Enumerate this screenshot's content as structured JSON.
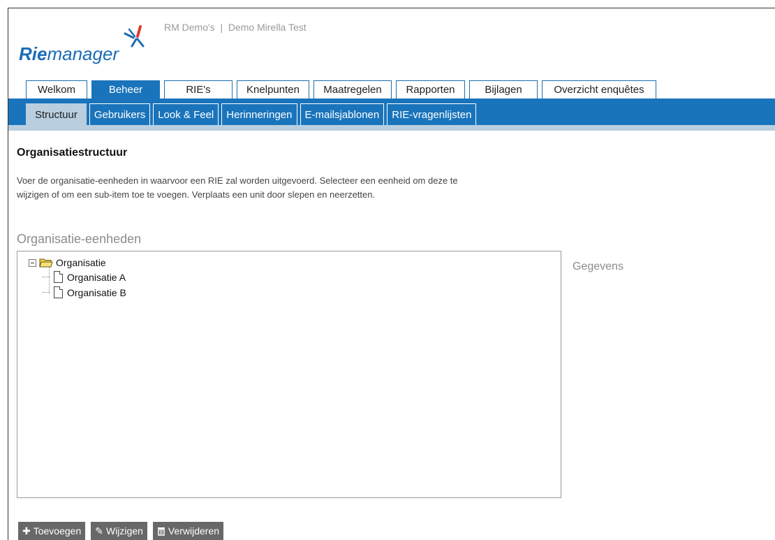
{
  "header": {
    "logo_bold": "Rie",
    "logo_light": "manager",
    "site_title": "RM Demo's  |  Demo Mirella Test"
  },
  "main_tabs": [
    {
      "label": "Welkom",
      "active": false
    },
    {
      "label": "Beheer",
      "active": true
    },
    {
      "label": "RIE's",
      "active": false
    },
    {
      "label": "Knelpunten",
      "active": false
    },
    {
      "label": "Maatregelen",
      "active": false
    },
    {
      "label": "Rapporten",
      "active": false
    },
    {
      "label": "Bijlagen",
      "active": false
    },
    {
      "label": "Overzicht enquêtes",
      "active": false
    }
  ],
  "sub_tabs": [
    {
      "label": "Structuur",
      "active": true
    },
    {
      "label": "Gebruikers",
      "active": false
    },
    {
      "label": "Look & Feel",
      "active": false
    },
    {
      "label": "Herinneringen",
      "active": false
    },
    {
      "label": "E-mailsjablonen",
      "active": false
    },
    {
      "label": "RIE-vragenlijsten",
      "active": false
    }
  ],
  "content": {
    "title": "Organisatiestructuur",
    "intro_line1": "Voer de organisatie-eenheden in waarvoor een RIE zal worden uitgevoerd. Selecteer een eenheid om deze te",
    "intro_line2": "wijzigen of om een sub-item toe te voegen. Verplaats een unit door slepen en neerzetten.",
    "section_title": "Organisatie-eenheden",
    "details_title": "Gegevens"
  },
  "tree": {
    "root": "Organisatie",
    "children": [
      "Organisatie A",
      "Organisatie B"
    ]
  },
  "buttons": {
    "add": "Toevoegen",
    "edit": "Wijzigen",
    "delete": "Verwijderen"
  },
  "colors": {
    "brand_blue": "#1a74bb",
    "sub_active": "#b9cfe0",
    "button_grey": "#686868"
  }
}
